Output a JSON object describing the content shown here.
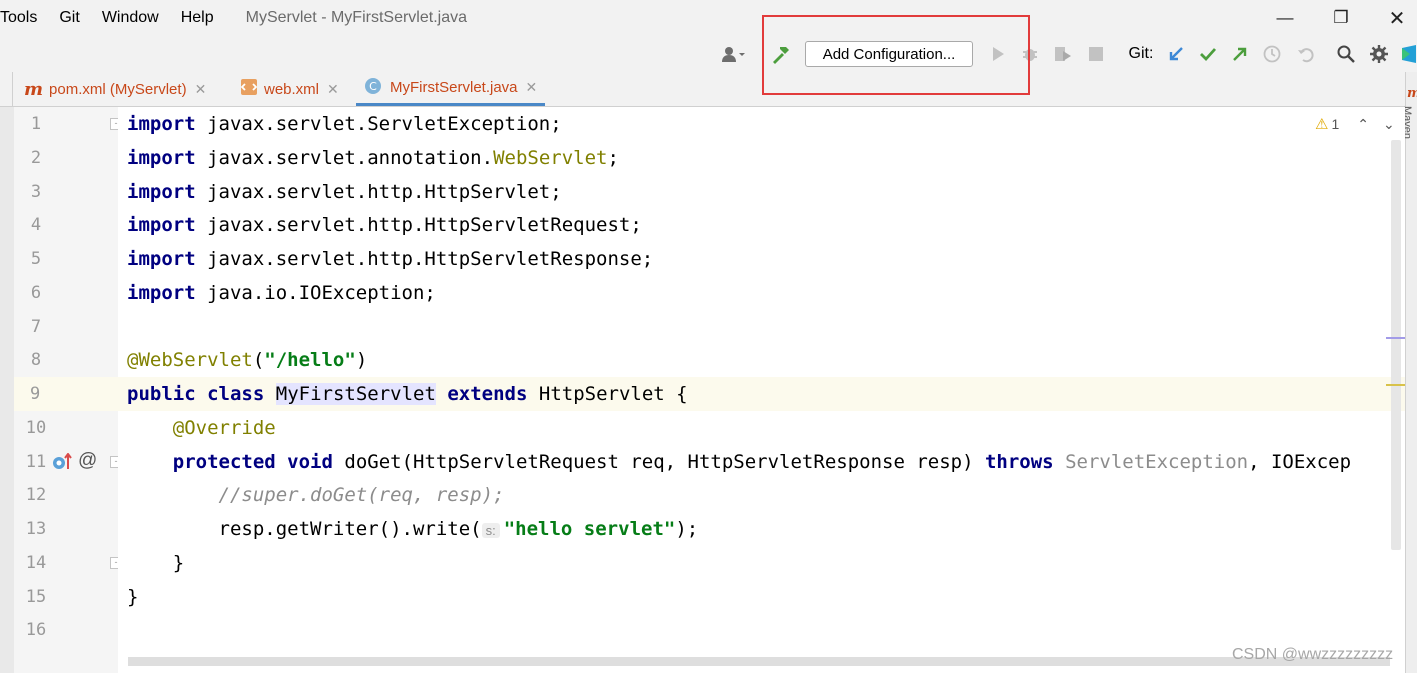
{
  "menu": {
    "items": [
      {
        "label": "Tools"
      },
      {
        "label": "Git"
      },
      {
        "label": "Window"
      },
      {
        "label": "Help"
      }
    ],
    "window_title": "MyServlet - MyFirstServlet.java"
  },
  "toolbar": {
    "add_configuration_label": "Add Configuration...",
    "git_label": "Git:",
    "icons": [
      "user-icon",
      "build-hammer-icon",
      "run-icon",
      "debug-icon",
      "coverage-icon",
      "stop-icon",
      "git-update-icon",
      "git-commit-icon",
      "git-push-icon",
      "history-icon",
      "rollback-icon",
      "search-icon",
      "settings-icon"
    ]
  },
  "tabs": [
    {
      "label": "pom.xml (MyServlet)",
      "icon": "maven-icon"
    },
    {
      "label": "web.xml",
      "icon": "xml-icon"
    },
    {
      "label": "MyFirstServlet.java",
      "icon": "java-class-icon",
      "active": true
    }
  ],
  "editor": {
    "warning_count": "1",
    "current_line": 9,
    "line_numbers": [
      "1",
      "2",
      "3",
      "4",
      "5",
      "6",
      "7",
      "8",
      "9",
      "10",
      "11",
      "12",
      "13",
      "14",
      "15",
      "16"
    ],
    "param_hint": "s:",
    "side_label": "Maven",
    "lines": [
      "import javax.servlet.ServletException;",
      "import javax.servlet.annotation.WebServlet;",
      "import javax.servlet.http.HttpServlet;",
      "import javax.servlet.http.HttpServletRequest;",
      "import javax.servlet.http.HttpServletResponse;",
      "import java.io.IOException;",
      "",
      "@WebServlet(\"/hello\")",
      "public class MyFirstServlet extends HttpServlet {",
      "    @Override",
      "    protected void doGet(HttpServletRequest req, HttpServletResponse resp) throws ServletException, IOExcep",
      "        //super.doGet(req, resp);",
      "        resp.getWriter().write( \"hello servlet\");",
      "    }",
      "}",
      ""
    ]
  },
  "watermark": "CSDN @wwzzzzzzzzz",
  "colors": {
    "keyword": "#000080",
    "string": "#067d17",
    "annotation": "#808000",
    "highlight_box": "#e23b3b"
  }
}
